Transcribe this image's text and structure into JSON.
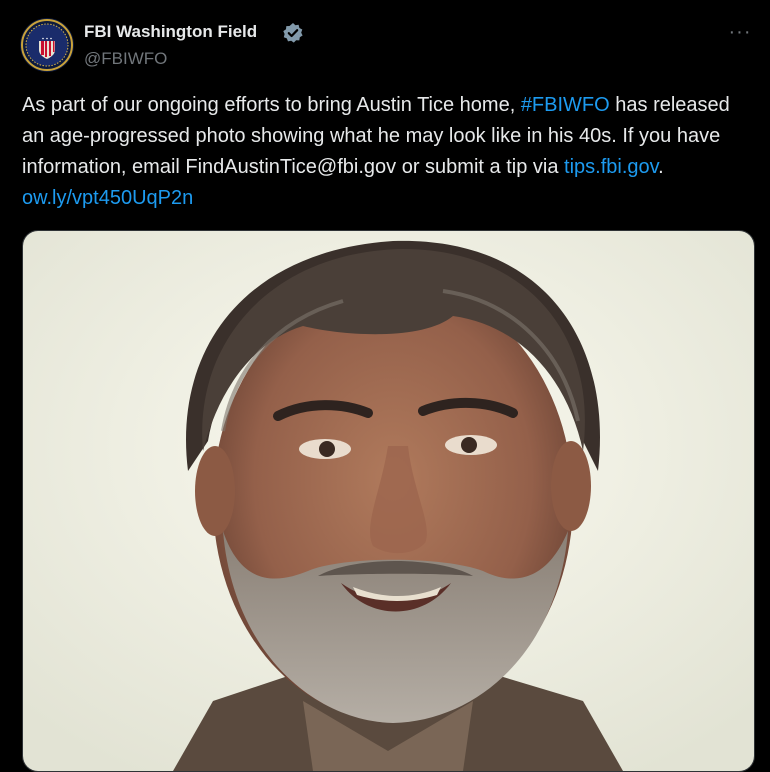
{
  "tweet": {
    "author": {
      "name": "FBI Washington Field",
      "handle": "@FBIWFO",
      "verified": true,
      "avatar_icon": "fbi-seal-icon"
    },
    "more_label": "···",
    "text": {
      "t1": "As part of our ongoing efforts to bring Austin Tice home, ",
      "hashtag": "#FBIWFO",
      "t2": " has released an age-progressed photo showing what he may look like in his 40s. If you have information, email FindAustinTice@fbi.gov or submit a tip via ",
      "link1": "tips.fbi.gov",
      "t3": ". ",
      "link2": "ow.ly/vpt450UqP2n"
    },
    "colors": {
      "background": "#000000",
      "text": "#e7e9ea",
      "secondary": "#71767b",
      "link": "#1d9bf0",
      "verified": "#829aab"
    }
  }
}
